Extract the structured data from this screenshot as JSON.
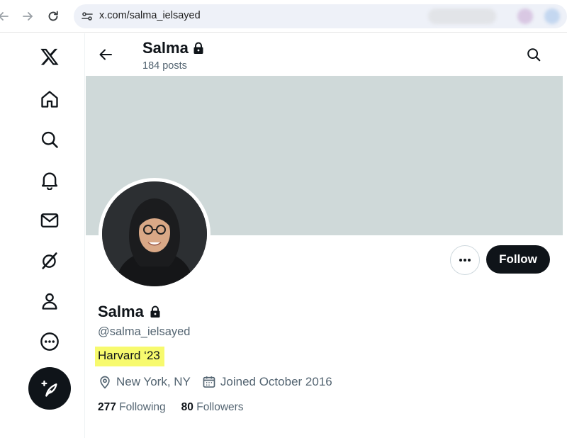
{
  "browser": {
    "url": "x.com/salma_ielsayed"
  },
  "nav": {
    "icons": [
      "x-logo-icon",
      "home-icon",
      "explore-icon",
      "notifications-icon",
      "messages-icon",
      "grok-icon",
      "profile-icon",
      "more-icon"
    ],
    "post_button_icon": "compose-icon"
  },
  "header": {
    "name": "Salma",
    "posts_count": "184 posts"
  },
  "profile": {
    "name": "Salma",
    "handle": "@salma_ielsayed",
    "bio": "Harvard ‘23",
    "location": "New York, NY",
    "joined": "Joined October 2016",
    "following_count": "277",
    "following_label": "Following",
    "followers_count": "80",
    "followers_label": "Followers",
    "follow_button": "Follow"
  },
  "colors": {
    "banner": "#cfd9d9",
    "highlight": "#f7fa6e",
    "primary_button": "#0f1419",
    "secondary_text": "#536471"
  }
}
